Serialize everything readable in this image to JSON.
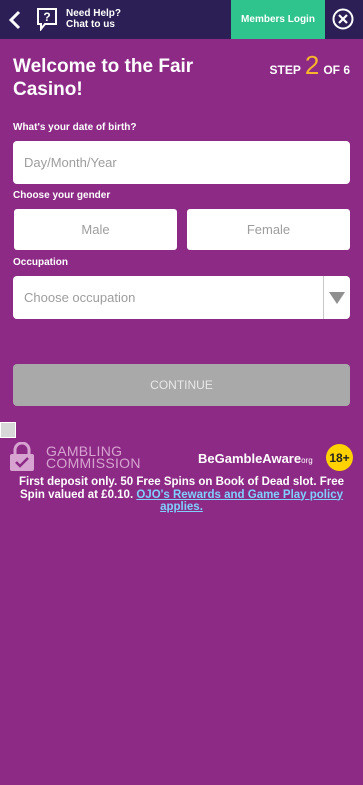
{
  "header": {
    "back_icon": "chevron-left-icon",
    "help_icon": "question-mark-icon",
    "help_line1": "Need Help?",
    "help_line2": "Chat to us",
    "members_login": "Members Login",
    "close_icon": "close-icon"
  },
  "page": {
    "title": "Welcome to the Fair Casino!",
    "step_label": "STEP",
    "step_current": "2",
    "step_total": "OF 6"
  },
  "form": {
    "dob_label": "What's your date of birth?",
    "dob_placeholder": "Day/Month/Year",
    "gender_label": "Choose your gender",
    "gender_options": [
      "Male",
      "Female"
    ],
    "occupation_label": "Occupation",
    "occupation_placeholder": "Choose occupation",
    "continue_label": "CONTINUE"
  },
  "footer": {
    "gc_line1": "GAMBLING",
    "gc_line2": "COMMISSION",
    "bga_text": "BeGambleAware",
    "bga_org": "org",
    "age_badge": "18+",
    "disclaimer": "First deposit only. 50 Free Spins on Book of Dead slot. Free Spin valued at £0.10.",
    "terms_link": "OJO's Rewards and Game Play policy applies."
  },
  "colors": {
    "background": "#8c2a85",
    "topbar": "#2c1f55",
    "members_button": "#2fc48d",
    "step_accent": "#f7b52b",
    "continue_disabled": "#a9a9a9",
    "age_badge": "#ffd200"
  }
}
